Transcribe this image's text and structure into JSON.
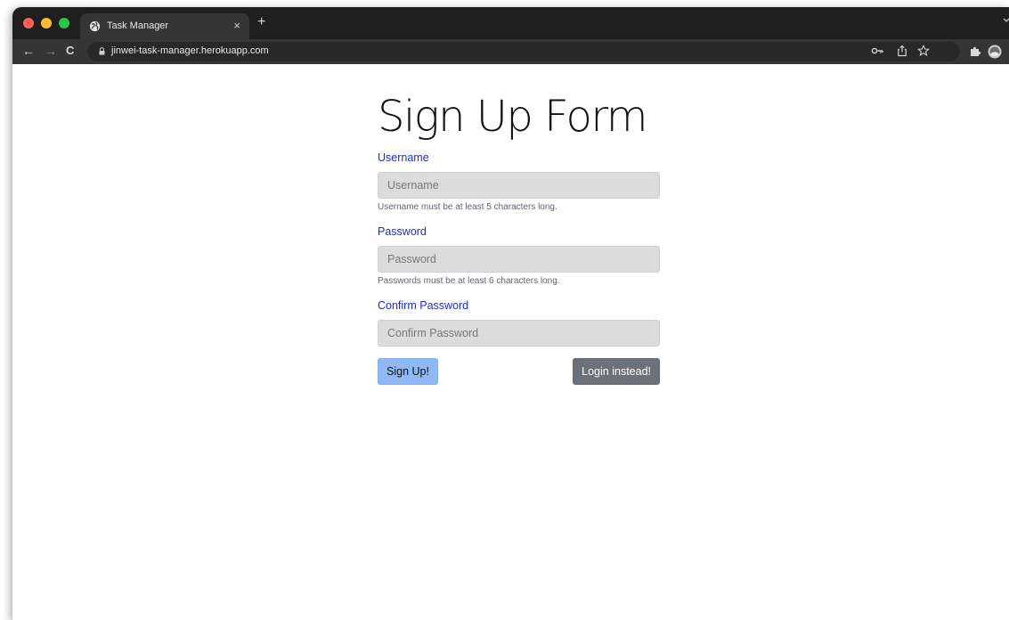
{
  "browser": {
    "tab": {
      "title": "Task Manager",
      "close_glyph": "×",
      "icon": "globe-icon"
    },
    "new_tab_glyph": "+",
    "address_bar": {
      "url": "jinwei-task-manager.herokuapp.com"
    },
    "nav": {
      "back_glyph": "←",
      "forward_glyph": "→",
      "reload_glyph": "C"
    },
    "icons": [
      "key-icon",
      "share-icon",
      "star-icon",
      "puzzle-icon",
      "profile-avatar"
    ]
  },
  "form": {
    "title": "Sign Up Form",
    "username": {
      "label": "Username",
      "placeholder": "Username",
      "help": "Username must be at least 5 characters long."
    },
    "password": {
      "label": "Password",
      "placeholder": "Password",
      "help": "Passwords must be at least 6 characters long."
    },
    "confirm_password": {
      "label": "Confirm Password",
      "placeholder": "Confirm Password"
    },
    "signup_label": "Sign Up!",
    "login_label": "Login instead!"
  },
  "colors": {
    "label_blue": "#1a2dd8",
    "signup_bg": "#8fb8f7",
    "login_bg": "#6b7178",
    "input_bg": "#dcdcdc",
    "chrome_dark": "#1f1f1f",
    "toolbar": "#353535"
  }
}
